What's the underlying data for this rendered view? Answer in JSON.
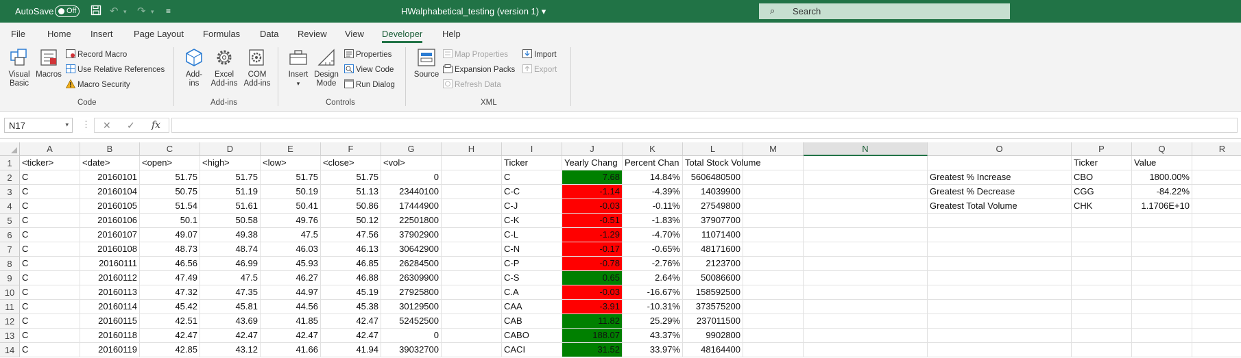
{
  "titlebar": {
    "autosave_label": "AutoSave",
    "autosave_state": "Off",
    "doc_title": "HWalphabetical_testing (version 1) ▾",
    "search_placeholder": "Search"
  },
  "menu": {
    "tabs": [
      "File",
      "Home",
      "Insert",
      "Page Layout",
      "Formulas",
      "Data",
      "Review",
      "View",
      "Developer",
      "Help"
    ],
    "active": "Developer"
  },
  "ribbon": {
    "code": {
      "visual_basic": [
        "Visual",
        "Basic"
      ],
      "macros": "Macros",
      "record_macro": "Record Macro",
      "use_relative": "Use Relative References",
      "macro_security": "Macro Security",
      "label": "Code"
    },
    "addins": {
      "addins": [
        "Add-",
        "ins"
      ],
      "excel_addins": [
        "Excel",
        "Add-ins"
      ],
      "com_addins": [
        "COM",
        "Add-ins"
      ],
      "label": "Add-ins"
    },
    "controls": {
      "insert": "Insert",
      "design_mode": [
        "Design",
        "Mode"
      ],
      "properties": "Properties",
      "view_code": "View Code",
      "run_dialog": "Run Dialog",
      "label": "Controls"
    },
    "xml": {
      "source": "Source",
      "map_properties": "Map Properties",
      "expansion_packs": "Expansion Packs",
      "refresh_data": "Refresh Data",
      "import": "Import",
      "export": "Export",
      "label": "XML"
    }
  },
  "formula_bar": {
    "name_box": "N17",
    "fx": "fx",
    "content": ""
  },
  "sheet": {
    "columns": [
      "A",
      "B",
      "C",
      "D",
      "E",
      "F",
      "G",
      "H",
      "I",
      "J",
      "K",
      "L",
      "M",
      "N",
      "O",
      "P",
      "Q",
      "R"
    ],
    "selected_column": "N",
    "row_numbers": [
      "1",
      "2",
      "3",
      "4",
      "5",
      "6",
      "7",
      "8",
      "9",
      "10",
      "11",
      "12",
      "13",
      "14"
    ],
    "headers_ag": [
      "<ticker>",
      "<date>",
      "<open>",
      "<high>",
      "<low>",
      "<close>",
      "<vol>"
    ],
    "rows_ag": [
      [
        "C",
        "20160101",
        "51.75",
        "51.75",
        "51.75",
        "51.75",
        "0"
      ],
      [
        "C",
        "20160104",
        "50.75",
        "51.19",
        "50.19",
        "51.13",
        "23440100"
      ],
      [
        "C",
        "20160105",
        "51.54",
        "51.61",
        "50.41",
        "50.86",
        "17444900"
      ],
      [
        "C",
        "20160106",
        "50.1",
        "50.58",
        "49.76",
        "50.12",
        "22501800"
      ],
      [
        "C",
        "20160107",
        "49.07",
        "49.38",
        "47.5",
        "47.56",
        "37902900"
      ],
      [
        "C",
        "20160108",
        "48.73",
        "48.74",
        "46.03",
        "46.13",
        "30642900"
      ],
      [
        "C",
        "20160111",
        "46.56",
        "46.99",
        "45.93",
        "46.85",
        "26284500"
      ],
      [
        "C",
        "20160112",
        "47.49",
        "47.5",
        "46.27",
        "46.88",
        "26309900"
      ],
      [
        "C",
        "20160113",
        "47.32",
        "47.35",
        "44.97",
        "45.19",
        "27925800"
      ],
      [
        "C",
        "20160114",
        "45.42",
        "45.81",
        "44.56",
        "45.38",
        "30129500"
      ],
      [
        "C",
        "20160115",
        "42.51",
        "43.69",
        "41.85",
        "42.47",
        "52452500"
      ],
      [
        "C",
        "20160118",
        "42.47",
        "42.47",
        "42.47",
        "42.47",
        "0"
      ],
      [
        "C",
        "20160119",
        "42.85",
        "43.12",
        "41.66",
        "41.94",
        "39032700"
      ]
    ],
    "summary_headers": [
      "Ticker",
      "Yearly Chang",
      "Percent Chan",
      "Total Stock Volume"
    ],
    "summary_rows": [
      {
        "ticker": "C",
        "change": "7.68",
        "pct": "14.84%",
        "volume": "5606480500",
        "color": "#008000"
      },
      {
        "ticker": "C-C",
        "change": "-1.14",
        "pct": "-4.39%",
        "volume": "14039900",
        "color": "#ff0000"
      },
      {
        "ticker": "C-J",
        "change": "-0.03",
        "pct": "-0.11%",
        "volume": "27549800",
        "color": "#ff0000"
      },
      {
        "ticker": "C-K",
        "change": "-0.51",
        "pct": "-1.83%",
        "volume": "37907700",
        "color": "#ff0000"
      },
      {
        "ticker": "C-L",
        "change": "-1.29",
        "pct": "-4.70%",
        "volume": "11071400",
        "color": "#ff0000"
      },
      {
        "ticker": "C-N",
        "change": "-0.17",
        "pct": "-0.65%",
        "volume": "48171600",
        "color": "#ff0000"
      },
      {
        "ticker": "C-P",
        "change": "-0.78",
        "pct": "-2.76%",
        "volume": "2123700",
        "color": "#ff0000"
      },
      {
        "ticker": "C-S",
        "change": "0.65",
        "pct": "2.64%",
        "volume": "50086600",
        "color": "#008000"
      },
      {
        "ticker": "C.A",
        "change": "-0.03",
        "pct": "-16.67%",
        "volume": "158592500",
        "color": "#ff0000"
      },
      {
        "ticker": "CAA",
        "change": "-3.91",
        "pct": "-10.31%",
        "volume": "373575200",
        "color": "#ff0000"
      },
      {
        "ticker": "CAB",
        "change": "11.82",
        "pct": "25.29%",
        "volume": "237011500",
        "color": "#008000"
      },
      {
        "ticker": "CABO",
        "change": "188.07",
        "pct": "43.37%",
        "volume": "9902800",
        "color": "#008000"
      },
      {
        "ticker": "CACI",
        "change": "31.52",
        "pct": "33.97%",
        "volume": "48164400",
        "color": "#008000"
      }
    ],
    "greatest_headers": [
      "Ticker",
      "Value"
    ],
    "greatest_rows": [
      {
        "label": "Greatest % Increase",
        "ticker": "CBO",
        "value": "1800.00%"
      },
      {
        "label": "Greatest % Decrease",
        "ticker": "CGG",
        "value": "-84.22%"
      },
      {
        "label": "Greatest Total Volume",
        "ticker": "CHK",
        "value": "1.1706E+10"
      }
    ]
  }
}
